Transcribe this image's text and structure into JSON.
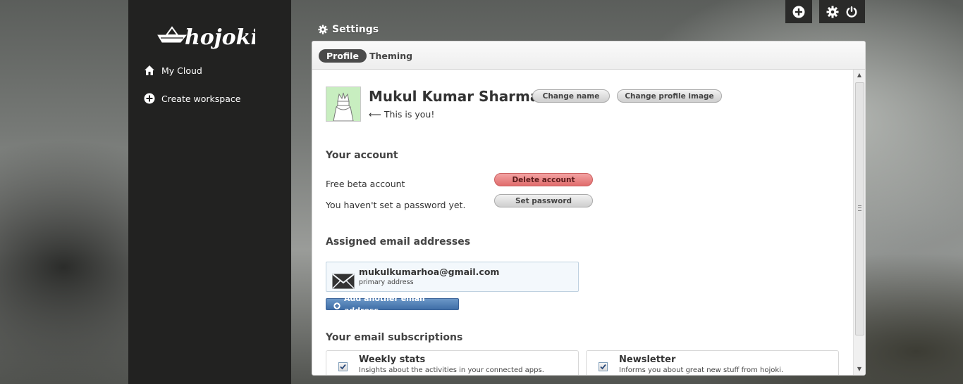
{
  "app": {
    "logo_text": "hojoki"
  },
  "sidebar": {
    "items": [
      {
        "label": "My Cloud",
        "icon": "home-icon"
      },
      {
        "label": "Create workspace",
        "icon": "plus-circle-icon"
      }
    ]
  },
  "topbar": {
    "icons": [
      "plus-circle-icon",
      "gear-icon",
      "power-icon"
    ]
  },
  "panel": {
    "title": "Settings"
  },
  "tabs": [
    {
      "label": "Profile",
      "active": true
    },
    {
      "label": "Theming",
      "active": false
    }
  ],
  "profile": {
    "name": "Mukul Kumar Sharma",
    "you_label": "⟵ This is you!",
    "change_name_label": "Change name",
    "change_image_label": "Change profile image"
  },
  "account": {
    "title": "Your account",
    "type_label": "Free beta account",
    "delete_label": "Delete account",
    "password_label": "You haven't set a password yet.",
    "set_password_label": "Set password"
  },
  "emails": {
    "title": "Assigned email addresses",
    "items": [
      {
        "address": "mukulkumarhoa@gmail.com",
        "note": "primary address"
      }
    ],
    "add_label": "Add another email address"
  },
  "subscriptions": {
    "title": "Your email subscriptions",
    "items": [
      {
        "title": "Weekly stats",
        "description": "Insights about the activities in your connected apps.",
        "checked": true
      },
      {
        "title": "Newsletter",
        "description": "Informs you about great new stuff from hojoki.",
        "checked": true
      }
    ]
  },
  "colors": {
    "sidebar_bg": "#222221",
    "danger": "#e06c6c",
    "primary": "#4a78b0",
    "active_tab": "#4a4a4a"
  }
}
